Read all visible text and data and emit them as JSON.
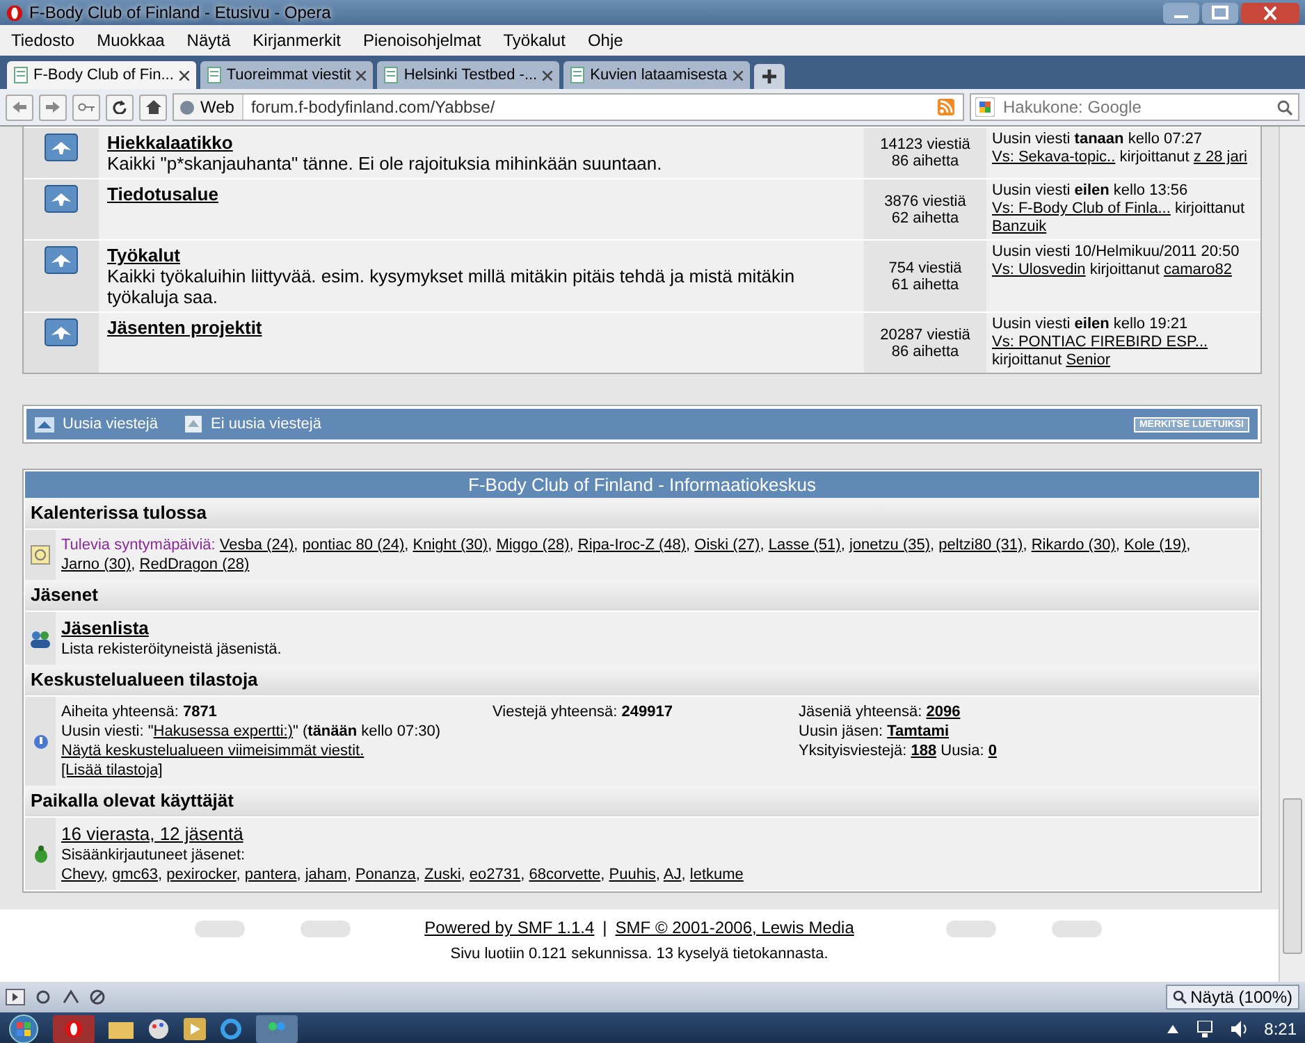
{
  "window": {
    "title": "F-Body Club of Finland - Etusivu - Opera"
  },
  "menu": [
    "Tiedosto",
    "Muokkaa",
    "Näytä",
    "Kirjanmerkit",
    "Pienoisohjelmat",
    "Työkalut",
    "Ohje"
  ],
  "tabs": [
    {
      "label": "F-Body Club of Fin...",
      "selected": true
    },
    {
      "label": "Tuoreimmat viestit",
      "selected": false
    },
    {
      "label": "Helsinki Testbed -...",
      "selected": false
    },
    {
      "label": "Kuvien lataamisesta",
      "selected": false
    }
  ],
  "address_bar": {
    "mode": "Web",
    "url": "forum.f-bodyfinland.com/Yabbse/",
    "search_placeholder": "Hakukone: Google"
  },
  "boards": [
    {
      "title": "Hiekkalaatikko",
      "description": "Kaikki \"p*skanjauhanta\" tänne. Ei ole rajoituksia mihinkään suuntaan.",
      "posts": "14123 viestiä",
      "topics": "86 aihetta",
      "last_post": {
        "when": "Uusin viesti **tanaan** kello 07:27",
        "topic": "Vs: Sekava-topic..",
        "by": "kirjoittanut",
        "author": "z 28 jari"
      }
    },
    {
      "title": "Tiedotusalue",
      "posts": "3876 viestiä",
      "topics": "62 aihetta",
      "last_post": {
        "when": "Uusin viesti **eilen** kello 13:56",
        "topic": "Vs: F-Body Club of Finla...",
        "by": "kirjoittanut",
        "author": "Banzuik"
      }
    },
    {
      "title": "Työkalut",
      "description": "Kaikki työkaluihin liittyvää. esim. kysymykset millä mitäkin pitäis tehdä ja mistä mitäkin työkaluja saa.",
      "posts": "754 viestiä",
      "topics": "61 aihetta",
      "last_post": {
        "when": "Uusin viesti 10/Helmikuu/2011 20:50",
        "topic": "Vs: Ulosvedin",
        "by": "kirjoittanut",
        "author": "camaro82"
      }
    },
    {
      "title": "Jäsenten projektit",
      "posts": "20287 viestiä",
      "topics": "86 aihetta",
      "last_post": {
        "when": "Uusin viesti **eilen** kello 19:21",
        "topic": "Vs: PONTIAC FIREBIRD ESP...",
        "by": "kirjoittanut",
        "author": "Senior"
      }
    }
  ],
  "legend": {
    "new_posts": "Uusia viestejä",
    "no_new_posts": "Ei uusia viestejä",
    "mark_read": "MERKITSE LUETUIKSI"
  },
  "info_center": {
    "title": "F-Body Club of Finland - Informaatiokeskus",
    "separator": ",",
    "calendar": {
      "heading": "Kalenterissa tulossa",
      "label": "Tulevia syntymäpäiviä:",
      "birthdays": [
        "Vesba (24)",
        "pontiac 80 (24)",
        "Knight (30)",
        "Miggo (28)",
        "Ripa-Iroc-Z (48)",
        "Oiski (27)",
        "Lasse (51)",
        "jonetzu (35)",
        "peltzi80 (31)",
        "Rikardo (30)",
        "Kole (19)",
        "Jarno (30)",
        "RedDragon (28)"
      ]
    },
    "members": {
      "heading": "Jäsenet",
      "title": "Jäsenlista",
      "description": "Lista rekisteröityneistä jäsenistä."
    },
    "stats": {
      "heading": "Keskustelualueen tilastoja",
      "topics_label": "Aiheita yhteensä:",
      "topics": "7871",
      "latest_label": "Uusin viesti: \"",
      "latest_topic": "Hakusessa expertti:)",
      "latest_time": "\" (**tänään** kello 07:30)",
      "recent_link": "Näytä keskustelualueen viimeisimmät viestit.",
      "more_link": "[Lisää tilastoja]",
      "posts_label": "Viestejä yhteensä:",
      "posts": "249917",
      "members_label": "Jäseniä yhteensä:",
      "members": "2096",
      "newest_label": "Uusin jäsen:",
      "newest": "Tamtami",
      "pm_label": "Yksityisviestejä:",
      "pm": "188",
      "unread_label": "Uusia:",
      "unread": "0"
    },
    "online": {
      "heading": "Paikalla olevat käyttäjät",
      "title": "16 vierasta, 12 jäsentä",
      "label": "Sisäänkirjautuneet jäsenet:",
      "users": [
        "Chevy",
        "gmc63",
        "pexirocker",
        "pantera",
        "jaham",
        "Ponanza",
        "Zuski",
        "eo2731",
        "68corvette",
        "Puuhis",
        "AJ",
        "letkume"
      ]
    }
  },
  "footer": {
    "powered": "Powered by SMF 1.1.4",
    "separator": "|",
    "copyright": "SMF © 2001-2006, Lewis Media",
    "timing": "Sivu luotiin 0.121 sekunnissa. 13 kyselyä tietokannasta."
  },
  "status_bar": {
    "zoom": "Näytä (100%)"
  },
  "taskbar": {
    "clock": "8:21"
  }
}
